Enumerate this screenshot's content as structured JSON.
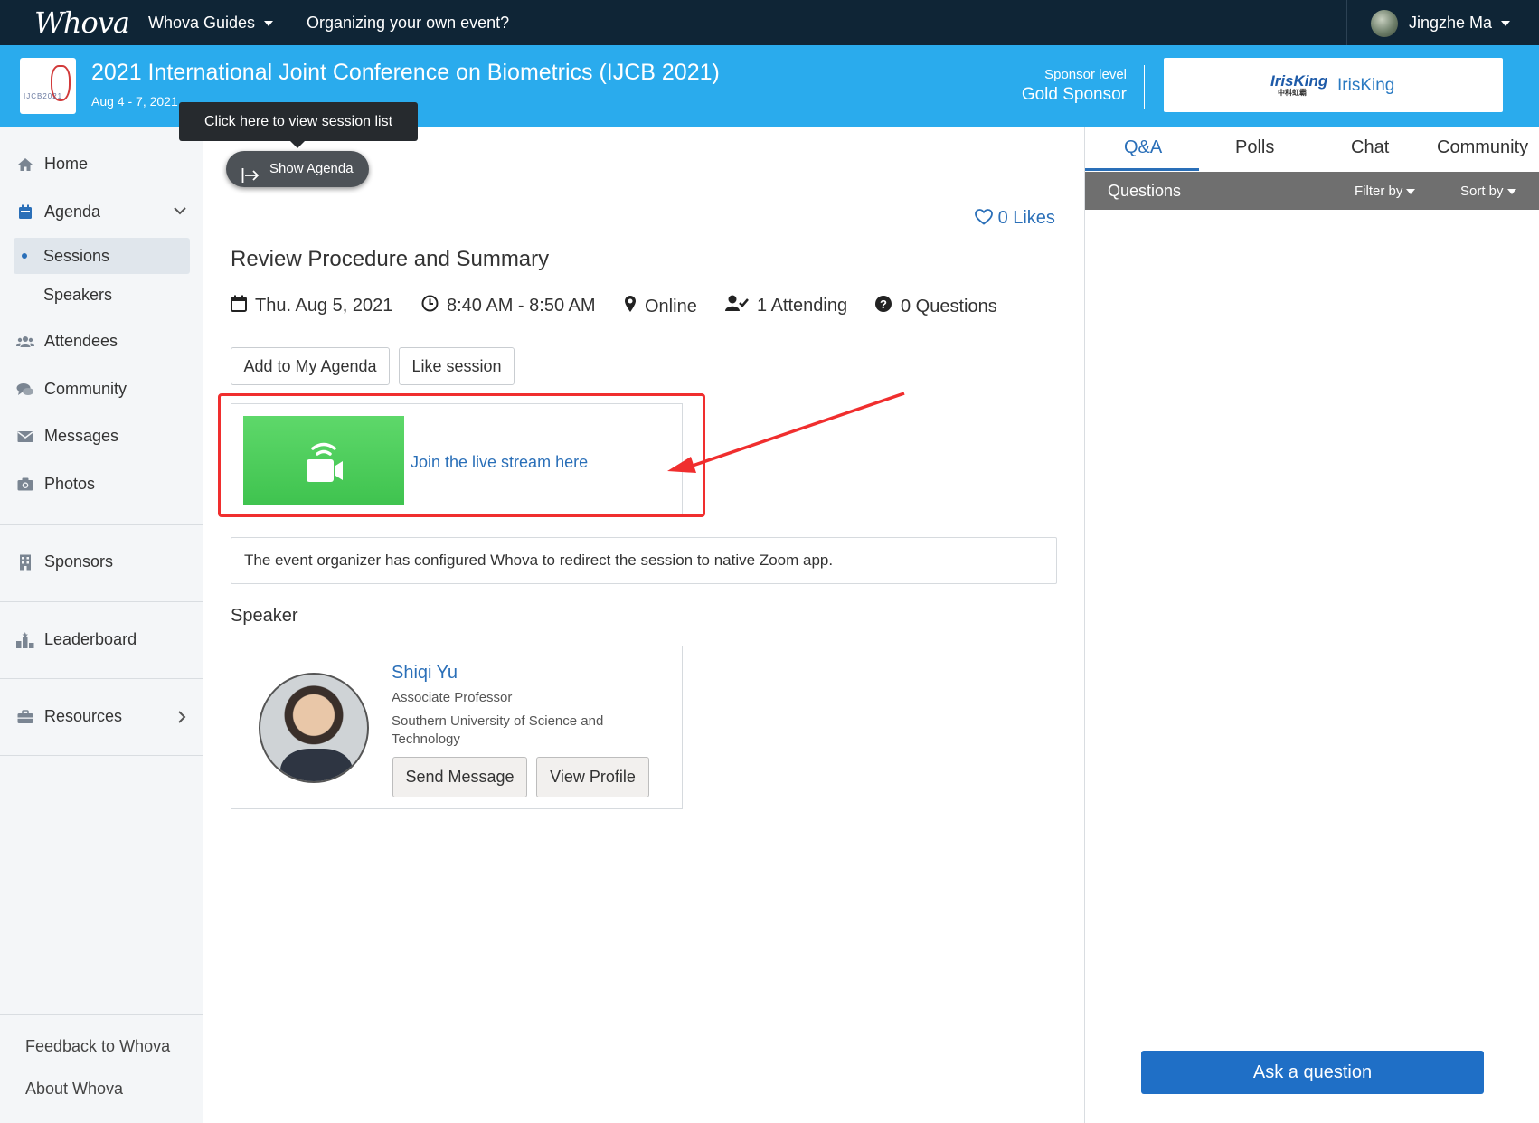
{
  "topnav": {
    "logo": "Whova",
    "guides": "Whova Guides",
    "organizing": "Organizing your own event?",
    "user_name": "Jingzhe Ma"
  },
  "event": {
    "logo_text": "IJCB2021",
    "title": "2021 International Joint Conference on Biometrics (IJCB 2021)",
    "dates": "Aug 4 - 7, 2021",
    "sponsor_label": "Sponsor level",
    "sponsor_level": "Gold Sponsor",
    "sponsor_logo": "IrisKing",
    "sponsor_logo_sub": "中科虹霸",
    "sponsor_name": "IrisKing"
  },
  "sidebar": {
    "home": "Home",
    "agenda": "Agenda",
    "sessions": "Sessions",
    "speakers": "Speakers",
    "attendees": "Attendees",
    "community": "Community",
    "messages": "Messages",
    "photos": "Photos",
    "sponsors": "Sponsors",
    "leaderboard": "Leaderboard",
    "resources": "Resources",
    "feedback": "Feedback to Whova",
    "about": "About Whova"
  },
  "main": {
    "tooltip": "Click here to view session list",
    "show_agenda": "Show Agenda",
    "likes": "0 Likes",
    "session_title": "Review Procedure and Summary",
    "date": "Thu. Aug 5, 2021",
    "time": "8:40 AM - 8:50 AM",
    "location": "Online",
    "attending": "1 Attending",
    "questions": "0 Questions",
    "add_to_agenda": "Add to My Agenda",
    "like_session": "Like session",
    "stream_link": "Join the live stream here",
    "notice": "The event organizer has configured Whova to redirect the session to native Zoom app.",
    "speaker_heading": "Speaker",
    "speaker": {
      "name": "Shiqi Yu",
      "role": "Associate Professor",
      "org": "Southern University of Science and Technology",
      "send_message": "Send Message",
      "view_profile": "View Profile"
    }
  },
  "right_panel": {
    "tabs": [
      "Q&A",
      "Polls",
      "Chat",
      "Community"
    ],
    "active_tab": "Q&A",
    "questions_title": "Questions",
    "filter_by": "Filter by",
    "sort_by": "Sort by",
    "ask_button": "Ask a question"
  },
  "colors": {
    "topnav_bg": "#0f2536",
    "event_bar": "#2aabed",
    "accent": "#2a6fb8",
    "stream_green": "#4ccb5a",
    "annotation_red": "#f02e2e",
    "ask_button": "#1f6fc6"
  }
}
